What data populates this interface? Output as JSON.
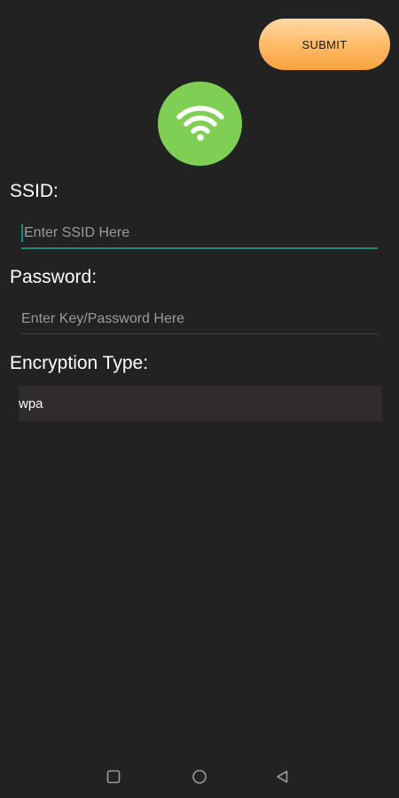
{
  "toolbar": {
    "submit_label": "SUBMIT"
  },
  "icons": {
    "wifi": "wifi-icon",
    "nav_recent": "square-icon",
    "nav_home": "circle-icon",
    "nav_back": "triangle-back-icon"
  },
  "form": {
    "ssid": {
      "label": "SSID:",
      "placeholder": "Enter SSID Here",
      "value": ""
    },
    "password": {
      "label": "Password:",
      "placeholder": "Enter Key/Password Here",
      "value": ""
    },
    "encryption": {
      "label": "Encryption Type:",
      "selected": "wpa"
    }
  },
  "colors": {
    "background": "#222222",
    "accent": "#1f8a82",
    "submit_gradient_top": "#ffd9a8",
    "submit_gradient_bottom": "#f7a23c",
    "wifi_circle": "#7fcf55"
  }
}
